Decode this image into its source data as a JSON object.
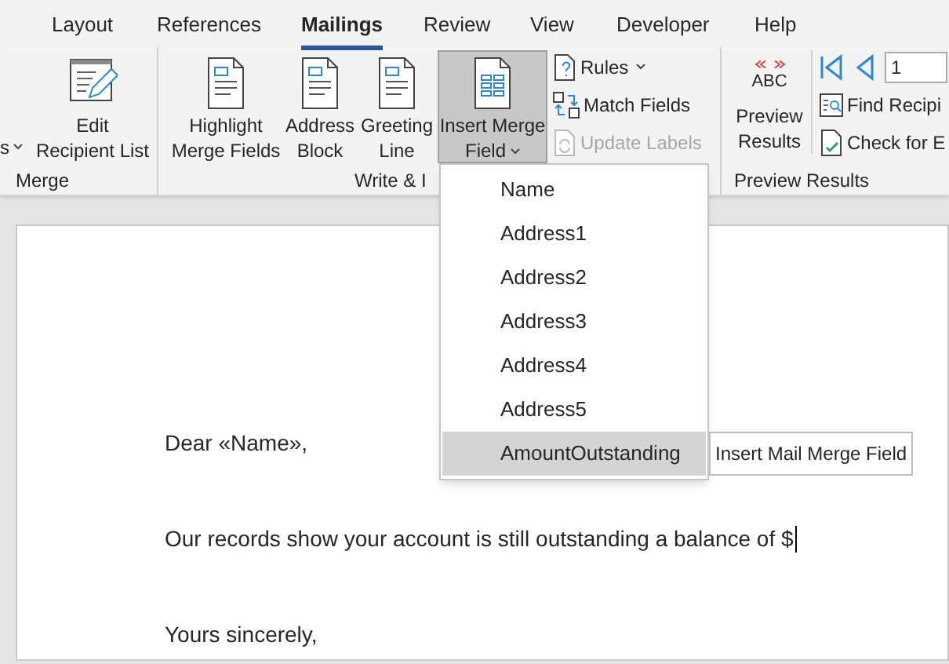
{
  "tabs": [
    {
      "label": "Layout",
      "selected": false
    },
    {
      "label": "References",
      "selected": false
    },
    {
      "label": "Mailings",
      "selected": true
    },
    {
      "label": "Review",
      "selected": false
    },
    {
      "label": "View",
      "selected": false
    },
    {
      "label": "Developer",
      "selected": false
    },
    {
      "label": "Help",
      "selected": false
    }
  ],
  "ribbon": {
    "merge_group": {
      "label": "Merge",
      "cut_button": "s",
      "edit_button": [
        "Edit",
        "Recipient List"
      ]
    },
    "write_group": {
      "label": "Write & I",
      "large_buttons": [
        {
          "kind": "highlight",
          "lines": [
            "Highlight",
            "Merge Fields"
          ],
          "expanded": false
        },
        {
          "kind": "address",
          "lines": [
            "Address",
            "Block"
          ],
          "expanded": false
        },
        {
          "kind": "greeting",
          "lines": [
            "Greeting",
            "Line"
          ],
          "expanded": false
        },
        {
          "kind": "insert",
          "lines": [
            "Insert Merge",
            "Field"
          ],
          "expanded": true
        }
      ],
      "small_buttons": [
        {
          "kind": "rules",
          "label": "Rules",
          "disabled": false
        },
        {
          "kind": "match",
          "label": "Match Fields",
          "disabled": false
        },
        {
          "kind": "update",
          "label": "Update Labels",
          "disabled": true
        }
      ]
    },
    "preview_group": {
      "label": "Preview Results",
      "abc": "ABC",
      "preview_button": [
        "Preview",
        "Results"
      ],
      "record_value": "1",
      "find": "Find Recipi",
      "check": "Check for E"
    }
  },
  "menu": {
    "items": [
      {
        "label": "Name",
        "selected": false
      },
      {
        "label": "Address1",
        "selected": false
      },
      {
        "label": "Address2",
        "selected": false
      },
      {
        "label": "Address3",
        "selected": false
      },
      {
        "label": "Address4",
        "selected": false
      },
      {
        "label": "Address5",
        "selected": false
      },
      {
        "label": "AmountOutstanding",
        "selected": true
      }
    ],
    "tooltip": "Insert Mail Merge Field"
  },
  "document": {
    "paragraphs": [
      {
        "text": "Dear «Name»,",
        "cursor": false
      },
      {
        "text": "Our records show your account is still outstanding a balance of $",
        "cursor": true
      },
      {
        "text": "Yours sincerely,",
        "cursor": false
      }
    ]
  }
}
